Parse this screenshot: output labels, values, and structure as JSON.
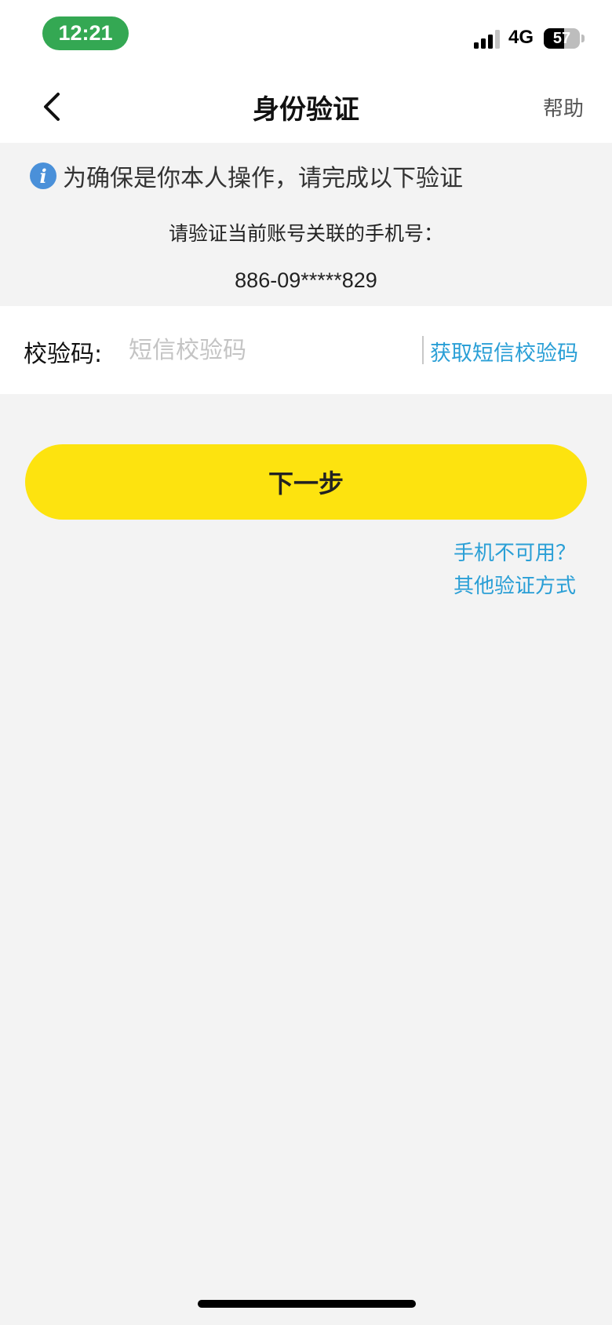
{
  "status_bar": {
    "time": "12:21",
    "network": "4G",
    "battery_level": "57",
    "battery_percent": 57
  },
  "nav": {
    "title": "身份验证",
    "help_label": "帮助"
  },
  "notice": {
    "text": "为确保是你本人操作，请完成以下验证"
  },
  "verify": {
    "prompt": "请验证当前账号关联的手机号：",
    "phone": "886-09*****829"
  },
  "code_field": {
    "label": "校验码:",
    "value": "",
    "placeholder": "短信校验码",
    "get_code_label": "获取短信校验码"
  },
  "next_button_label": "下一步",
  "alt": {
    "phone_unavailable": "手机不可用？",
    "other_methods": "其他验证方式"
  },
  "colors": {
    "accent_yellow": "#fde30f",
    "link_blue": "#2a9fd6",
    "time_pill_green": "#34a853",
    "background": "#f3f3f3"
  }
}
